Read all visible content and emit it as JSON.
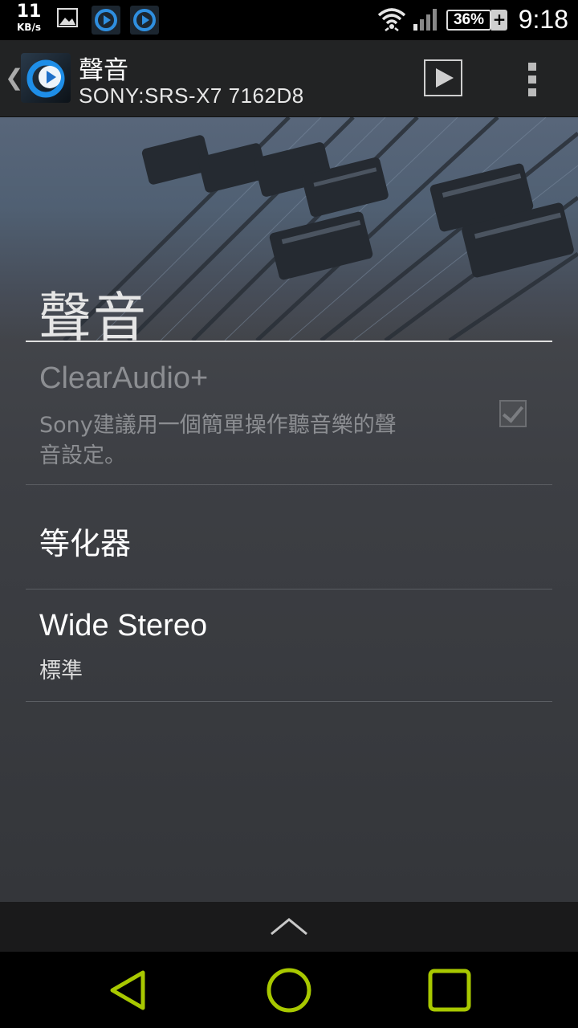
{
  "status_bar": {
    "speed_value": "11",
    "speed_unit": "KB/s",
    "battery_percent": "36%",
    "battery_charging_symbol": "+",
    "time": "9:18",
    "icons": [
      "gallery-icon",
      "app-notification-icon",
      "app-notification-icon",
      "wifi-icon",
      "signal-icon",
      "battery-icon"
    ]
  },
  "action_bar": {
    "up_symbol": "❮",
    "title": "聲音",
    "subtitle": "SONY:SRS-X7 7162D8",
    "icons": [
      "app-logo",
      "throw-icon",
      "overflow-menu-icon"
    ]
  },
  "header": {
    "title": "聲音"
  },
  "preferences": {
    "clearaudio": {
      "title": "ClearAudio+",
      "summary_line1": "Sony建議用一個簡單操作聽音樂的聲",
      "summary_line2": "音設定。",
      "checked": true,
      "enabled": false
    },
    "equalizer": {
      "title": "等化器"
    },
    "wide_stereo": {
      "title": "Wide Stereo",
      "summary": "標準"
    }
  },
  "colors": {
    "nav_accent": "#a8c800",
    "background": "#3d3f44",
    "disabled_text": "#8c8e92"
  }
}
